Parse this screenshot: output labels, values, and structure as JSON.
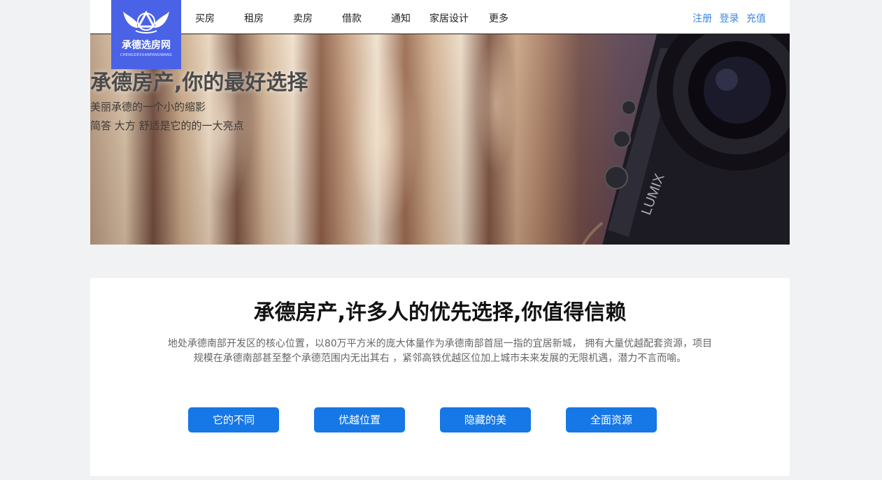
{
  "logo": {
    "title": "承德选房网",
    "subtitle": "CHENGDEXUANFANGWANG",
    "icon": "winged-emblem-icon"
  },
  "nav": {
    "items": [
      "买房",
      "租房",
      "卖房",
      "借款",
      "通知",
      "家居设计",
      "更多"
    ]
  },
  "auth": {
    "register": "注册",
    "login": "登录",
    "recharge": "充值"
  },
  "hero": {
    "title": "承德房产,你的最好选择",
    "line1": "美丽承德的一个小的缩影",
    "line2": "简答 大方 舒适是它的的一大亮点"
  },
  "content": {
    "title": "承德房产,许多人的优先选择,你值得信赖",
    "desc_line1": "地处承德南部开发区的核心位置，以80万平方米的庞大体量作为承德南部首屈一指的宜居新城， 拥有大量优越配套资源，项目",
    "desc_line2": "规模在承德南部甚至整个承德范围内无出其右 ，紧邻高铁优越区位加上城市未来发展的无限机遇，潜力不言而喻。",
    "buttons": [
      "它的不同",
      "优越位置",
      "隐藏的美",
      "全面资源"
    ]
  },
  "colors": {
    "logo_bg": "#4a62e6",
    "accent": "#1677e6",
    "link": "#3c86e6",
    "page_bg": "#f1f2f4"
  }
}
